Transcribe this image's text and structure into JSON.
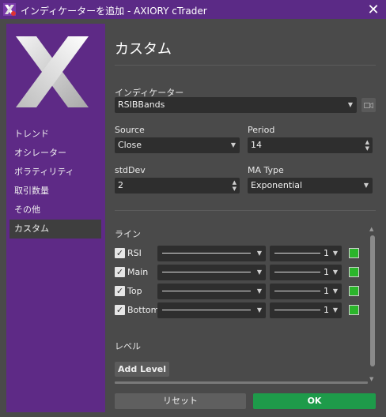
{
  "window": {
    "title": "インディケーターを追加 - AXIORY cTrader",
    "close_glyph": "✕",
    "accent_color": "#5e2a86"
  },
  "sidebar": {
    "items": [
      {
        "label": "トレンド"
      },
      {
        "label": "オシレーター"
      },
      {
        "label": "ボラティリティ"
      },
      {
        "label": "取引数量"
      },
      {
        "label": "その他"
      },
      {
        "label": "カスタム",
        "active": true
      }
    ]
  },
  "main": {
    "title": "カスタム",
    "indicator": {
      "label": "インディケーター",
      "value": "RSIBBands"
    },
    "source": {
      "label": "Source",
      "value": "Close"
    },
    "period": {
      "label": "Period",
      "value": "14"
    },
    "stddev": {
      "label": "stdDev",
      "value": "2"
    },
    "ma_type": {
      "label": "MA Type",
      "value": "Exponential"
    },
    "lines_title": "ライン",
    "lines": [
      {
        "name": "RSI",
        "checked": true,
        "width": "1",
        "color": "#2bb52b"
      },
      {
        "name": "Main",
        "checked": true,
        "width": "1",
        "color": "#2bb52b"
      },
      {
        "name": "Top",
        "checked": true,
        "width": "1",
        "color": "#2bb52b"
      },
      {
        "name": "Bottom",
        "checked": true,
        "width": "1",
        "color": "#2bb52b"
      }
    ],
    "levels_title": "レベル",
    "add_level_label": "Add Level"
  },
  "footer": {
    "reset_label": "リセット",
    "ok_label": "OK",
    "ok_color": "#1e9b4a"
  },
  "icons": {
    "dropdown": "chevron-down-icon",
    "spinner": "spin-arrows-icon",
    "video": "video-camera-icon",
    "checkbox": "checkmark-icon",
    "logo": "axiory-x-logo"
  }
}
